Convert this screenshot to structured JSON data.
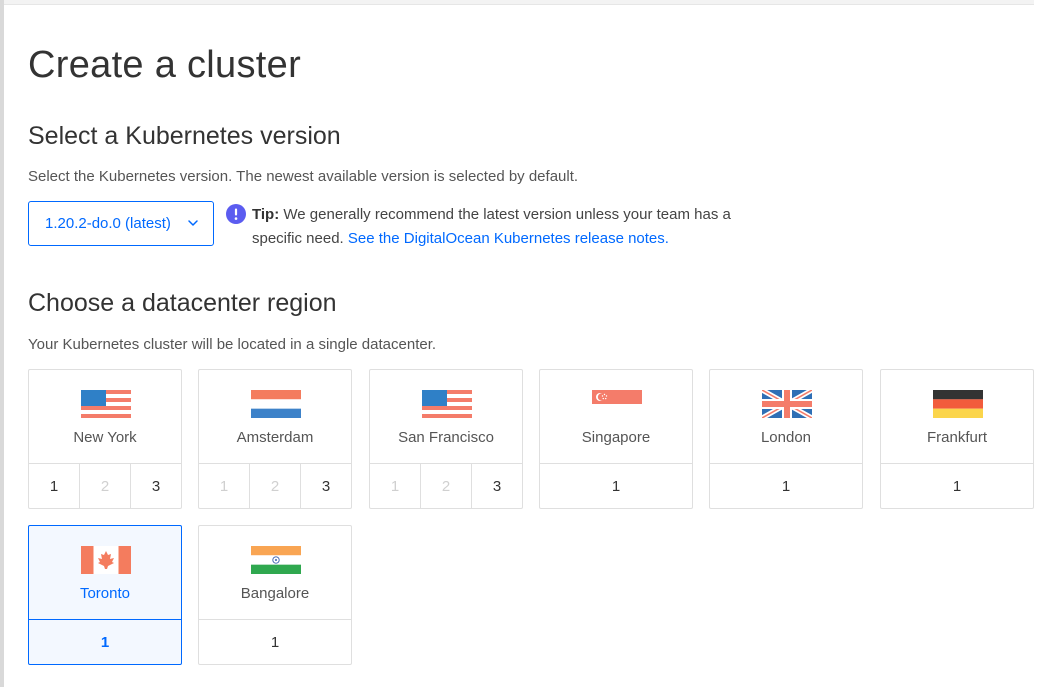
{
  "page_title": "Create a cluster",
  "version_section": {
    "title": "Select a Kubernetes version",
    "description": "Select the Kubernetes version. The newest available version is selected by default.",
    "selected_version": "1.20.2-do.0 (latest)",
    "tip_label": "Tip:",
    "tip_text": "We generally recommend the latest version unless your team has a specific need.",
    "tip_link": "See the DigitalOcean Kubernetes release notes."
  },
  "region_section": {
    "title": "Choose a datacenter region",
    "description": "Your Kubernetes cluster will be located in a single datacenter.",
    "regions": [
      {
        "name": "New York",
        "datacenters": [
          "1",
          "2",
          "3"
        ]
      },
      {
        "name": "Amsterdam",
        "datacenters": [
          "1",
          "2",
          "3"
        ]
      },
      {
        "name": "San Francisco",
        "datacenters": [
          "1",
          "2",
          "3"
        ]
      },
      {
        "name": "Singapore",
        "datacenters": [
          "1"
        ]
      },
      {
        "name": "London",
        "datacenters": [
          "1"
        ]
      },
      {
        "name": "Frankfurt",
        "datacenters": [
          "1"
        ]
      },
      {
        "name": "Toronto",
        "datacenters": [
          "1"
        ],
        "selected": true
      },
      {
        "name": "Bangalore",
        "datacenters": [
          "1"
        ]
      }
    ]
  },
  "colors": {
    "accent": "#0069ff",
    "tip_icon": "#5b5cf0",
    "disabled_text": "#d0d0d0"
  }
}
